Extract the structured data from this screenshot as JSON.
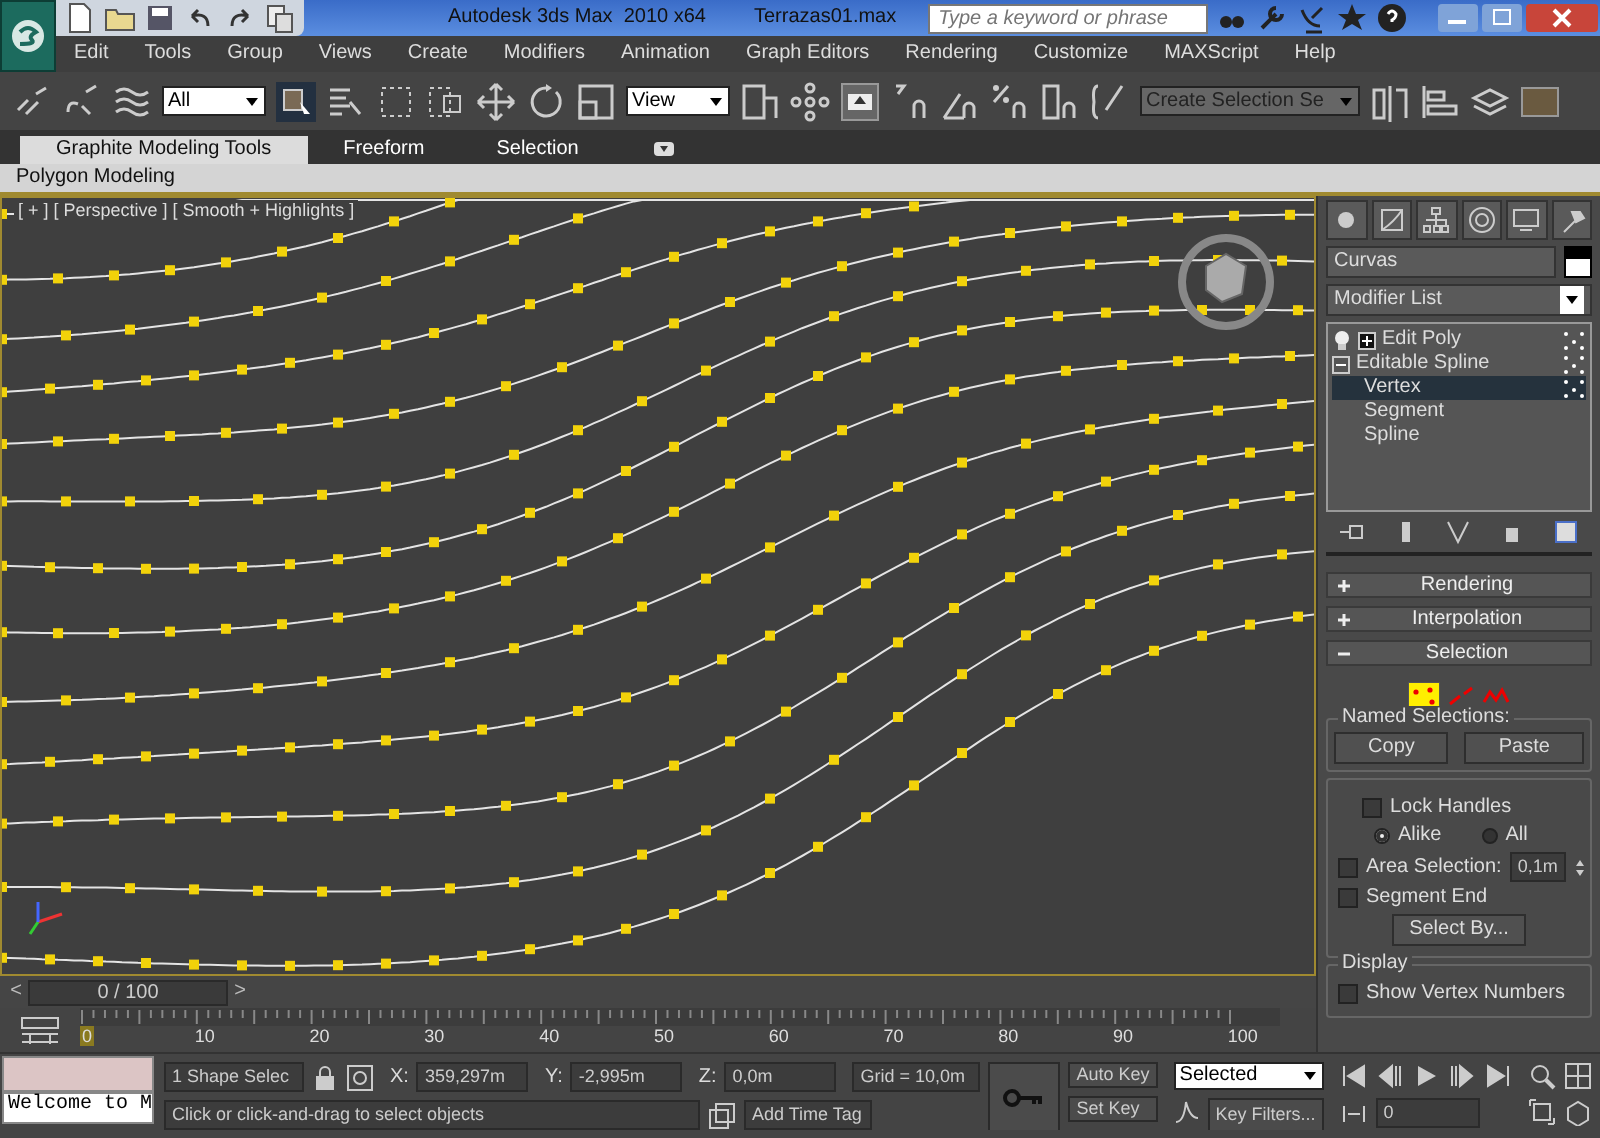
{
  "title_bar": {
    "app_title": "Autodesk 3ds Max  2010 x64",
    "file_name": "Terrazas01.max",
    "search": {
      "placeholder": "Type a keyword or phrase"
    }
  },
  "menu": [
    "Edit",
    "Tools",
    "Group",
    "Views",
    "Create",
    "Modifiers",
    "Animation",
    "Graph Editors",
    "Rendering",
    "Customize",
    "MAXScript",
    "Help"
  ],
  "main_toolbar": {
    "selection_filter": "All",
    "reference_coordinate": "View",
    "named_selection": "Create Selection Se"
  },
  "ribbon": {
    "tabs": [
      {
        "label": "Graphite Modeling Tools",
        "selected": true
      },
      {
        "label": "Freeform",
        "selected": false
      },
      {
        "label": "Selection",
        "selected": false
      }
    ],
    "panel": "Polygon Modeling"
  },
  "viewport": {
    "label": "[ + ] [ Perspective ] [ Smooth + Highlights ]"
  },
  "command_panel": {
    "object_name": "Curvas",
    "modifier_list": "Modifier List",
    "stack": [
      {
        "label": "Edit Poly",
        "expanded": false,
        "selected": false
      },
      {
        "label": "Editable Spline",
        "expanded": true,
        "selected": false,
        "children": [
          {
            "label": "Vertex",
            "selected": true
          },
          {
            "label": "Segment",
            "selected": false
          },
          {
            "label": "Spline",
            "selected": false
          }
        ]
      }
    ],
    "rollouts": [
      {
        "title": "Rendering",
        "expanded": false
      },
      {
        "title": "Interpolation",
        "expanded": false
      },
      {
        "title": "Selection",
        "expanded": true
      }
    ],
    "selection": {
      "named_selections": "Named Selections:",
      "copy": "Copy",
      "paste": "Paste",
      "options": [
        {
          "kind": "checkbox",
          "label": "Lock Handles",
          "checked": false
        },
        {
          "kind": "radios",
          "radios": [
            {
              "label": "Alike",
              "selected": true
            },
            {
              "label": "All",
              "selected": false
            }
          ]
        },
        {
          "kind": "spinner",
          "label": "Area Selection:",
          "checked": false,
          "value": "0,1m"
        },
        {
          "kind": "checkbox",
          "label": "Segment End",
          "checked": false
        },
        {
          "kind": "button",
          "label": "Select By..."
        }
      ],
      "display": {
        "title": "Display",
        "show_vertex_numbers": {
          "label": "Show Vertex Numbers",
          "checked": false
        }
      }
    }
  },
  "time_slider": {
    "prev": "<",
    "position": "0 / 100",
    "next": ">"
  },
  "track_bar": {
    "ticks": [
      "0",
      "10",
      "20",
      "30",
      "40",
      "50",
      "60",
      "70",
      "80",
      "90",
      "100"
    ]
  },
  "status_bar": {
    "listener": "Welcome to M",
    "selection_count": "1 Shape Selec",
    "x_label": "X:",
    "x": "359,297m",
    "y_label": "Y:",
    "y": "-2,995m",
    "z_label": "Z:",
    "z": "0,0m",
    "grid": "Grid = 10,0m",
    "prompt": "Click or click-and-drag to select objects",
    "add_time_tag": "Add Time Tag"
  },
  "animation": {
    "auto_key": "Auto Key",
    "set_key": "Set Key",
    "key_mode": "Selected",
    "key_filters": "Key Filters...",
    "frame": "0"
  }
}
